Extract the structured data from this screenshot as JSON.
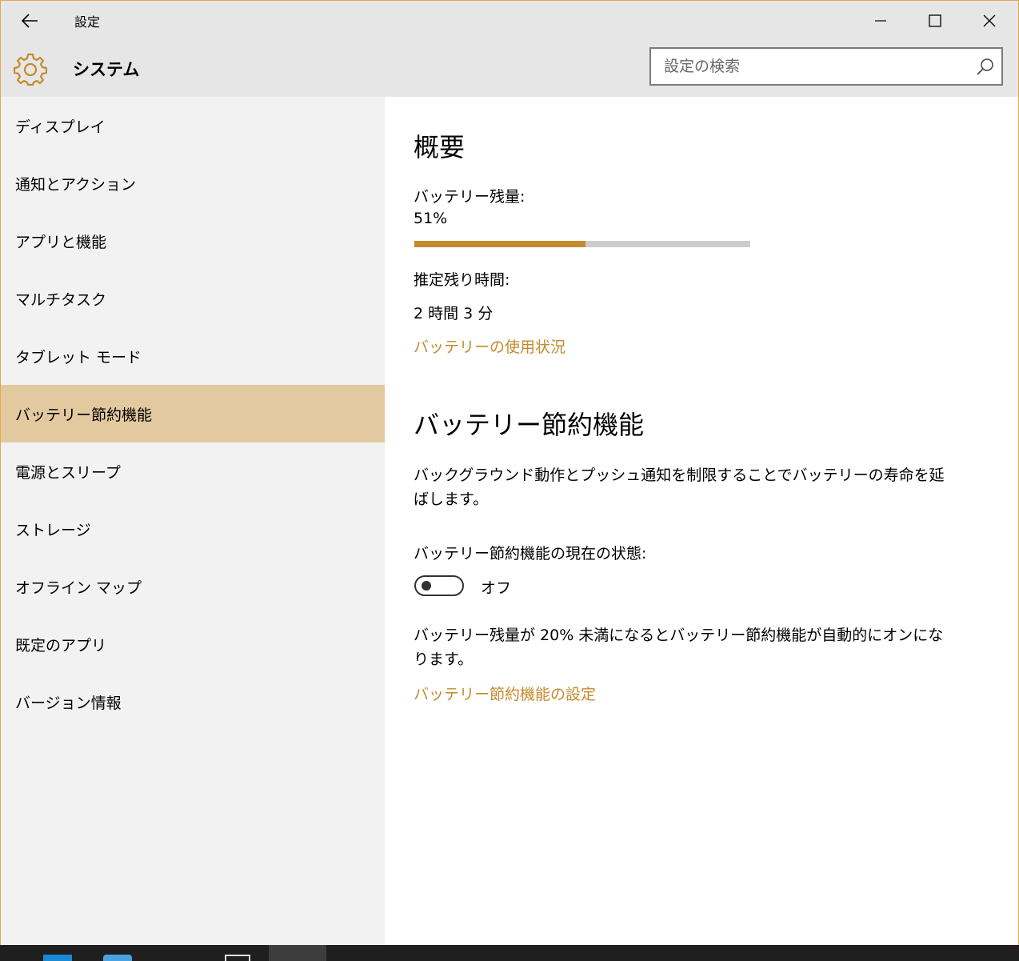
{
  "titlebar": {
    "title": "設定",
    "back_icon": "arrow-left-icon",
    "minimize_icon": "minimize-icon",
    "maximize_icon": "maximize-icon",
    "close_icon": "close-icon"
  },
  "header": {
    "icon": "gear-icon",
    "title": "システム",
    "search_placeholder": "設定の検索",
    "search_icon": "search-icon"
  },
  "sidebar": {
    "items": [
      {
        "label": "ディスプレイ",
        "active": false
      },
      {
        "label": "通知とアクション",
        "active": false
      },
      {
        "label": "アプリと機能",
        "active": false
      },
      {
        "label": "マルチタスク",
        "active": false
      },
      {
        "label": "タブレット モード",
        "active": false
      },
      {
        "label": "バッテリー節約機能",
        "active": true
      },
      {
        "label": "電源とスリープ",
        "active": false
      },
      {
        "label": "ストレージ",
        "active": false
      },
      {
        "label": "オフライン マップ",
        "active": false
      },
      {
        "label": "既定のアプリ",
        "active": false
      },
      {
        "label": "バージョン情報",
        "active": false
      }
    ]
  },
  "overview": {
    "title": "概要",
    "battery_label": "バッテリー残量:",
    "battery_value": "51%",
    "battery_fraction": 0.51,
    "remaining_label": "推定残り時間:",
    "remaining_value": "2 時間 3 分",
    "usage_link": "バッテリーの使用状況"
  },
  "saver": {
    "title": "バッテリー節約機能",
    "description": "バックグラウンド動作とプッシュ通知を制限することでバッテリーの寿命を延ばします。",
    "status_label": "バッテリー節約機能の現在の状態:",
    "toggle_state": "オフ",
    "auto_note": "バッテリー残量が 20% 未満になるとバッテリー節約機能が自動的にオンになります。",
    "settings_link": "バッテリー節約機能の設定"
  },
  "colors": {
    "accent": "#c48a2c",
    "active_item": "#e3c99f",
    "header_bg": "#e6e6e6",
    "sidebar_bg": "#f2f2f2"
  }
}
